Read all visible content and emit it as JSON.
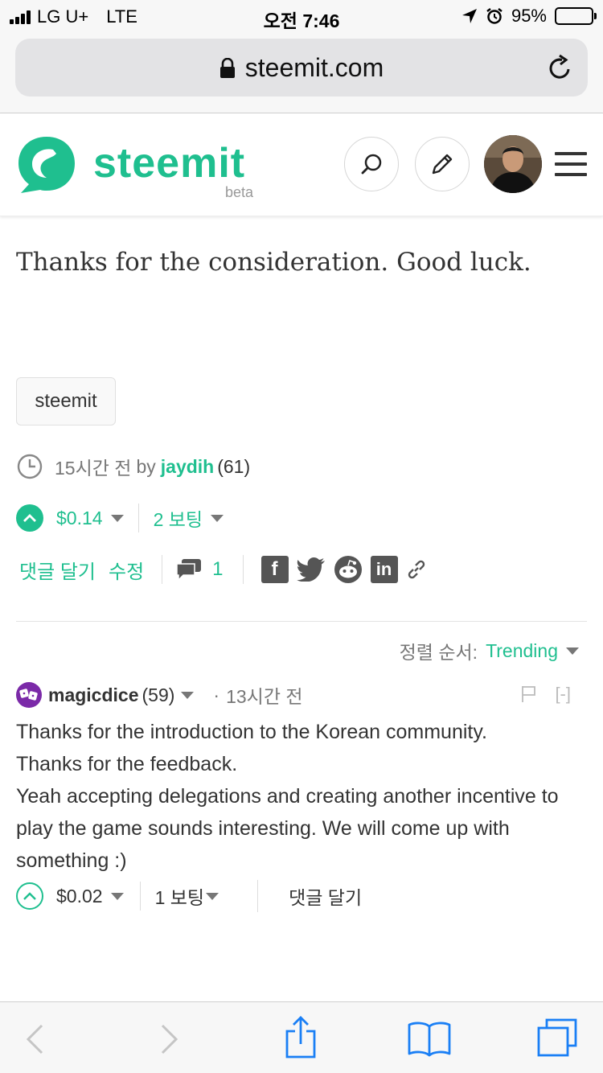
{
  "status_bar": {
    "carrier": "LG U+",
    "network": "LTE",
    "time": "오전 7:46",
    "battery_percent": "95%",
    "battery_level": 0.95
  },
  "browser": {
    "url": "steemit.com"
  },
  "header": {
    "brand": "steemit",
    "beta": "beta",
    "brand_color": "#1fbf8f"
  },
  "post": {
    "body": "Thanks for the consideration. Good luck.",
    "tag": "steemit",
    "time_ago": "15시간 전",
    "by": "by",
    "author": "jaydih",
    "reputation": "(61)",
    "payout": "$0.14",
    "votes": "2 보팅",
    "reply_label": "댓글 달기",
    "edit_label": "수정",
    "comment_count": "1"
  },
  "sort": {
    "label": "정렬 순서:",
    "value": "Trending"
  },
  "comment": {
    "author": "magicdice",
    "reputation": "(59)",
    "separator": "·",
    "time_ago": "13시간 전",
    "collapse": "[-]",
    "lines": [
      "Thanks for the introduction to the Korean community.",
      "Thanks for the feedback.",
      "Yeah accepting delegations and creating another incentive to play the game sounds interesting. We will come up with something :)"
    ],
    "payout": "$0.02",
    "votes": "1 보팅",
    "reply_label": "댓글 달기"
  }
}
